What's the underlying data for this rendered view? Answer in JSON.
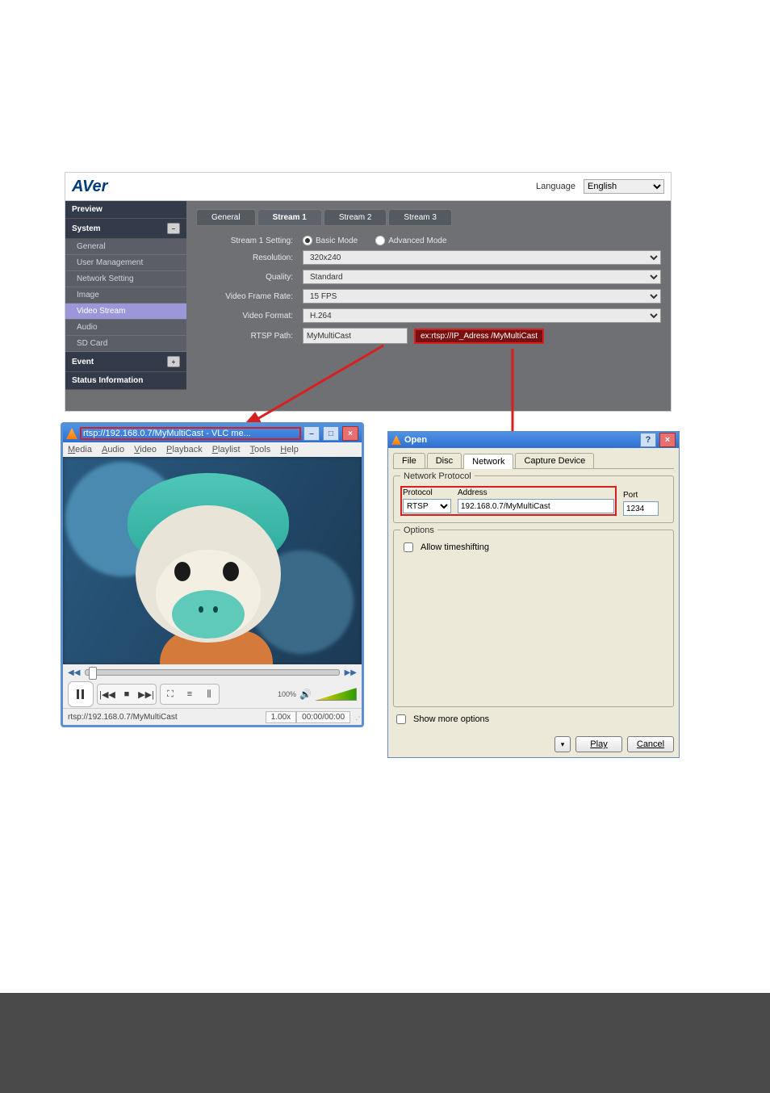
{
  "aver": {
    "logo": "AVer",
    "language_label": "Language",
    "language_value": "English",
    "sidebar": {
      "preview": "Preview",
      "system": "System",
      "items": [
        "General",
        "User Management",
        "Network Setting",
        "Image",
        "Video Stream",
        "Audio",
        "SD Card"
      ],
      "active_index": 4,
      "event": "Event",
      "status": "Status Information"
    },
    "tabs": [
      "General",
      "Stream 1",
      "Stream 2",
      "Stream 3"
    ],
    "active_tab": 1,
    "form": {
      "setting_label": "Stream 1 Setting:",
      "mode_basic": "Basic Mode",
      "mode_advanced": "Advanced Mode",
      "resolution_label": "Resolution:",
      "resolution_value": "320x240",
      "quality_label": "Quality:",
      "quality_value": "Standard",
      "fps_label": "Video Frame Rate:",
      "fps_value": "15 FPS",
      "format_label": "Video Format:",
      "format_value": "H.264",
      "rtsp_label": "RTSP Path:",
      "rtsp_value": "MyMultiCast",
      "rtsp_hint": "ex:rtsp://IP_Adress /MyMultiCast"
    }
  },
  "vlc": {
    "title": "rtsp://192.168.0.7/MyMultiCast - VLC me...",
    "menu": [
      "Media",
      "Audio",
      "Video",
      "Playback",
      "Playlist",
      "Tools",
      "Help"
    ],
    "volume_label": "100%",
    "status_path": "rtsp://192.168.0.7/MyMultiCast",
    "status_rate": "1.00x",
    "status_time": "00:00/00:00"
  },
  "dlg": {
    "title": "Open",
    "tabs": [
      "File",
      "Disc",
      "Network",
      "Capture Device"
    ],
    "active_tab": 2,
    "net_legend": "Network Protocol",
    "protocol_label": "Protocol",
    "protocol_value": "RTSP",
    "address_label": "Address",
    "address_value": "192.168.0.7/MyMultiCast",
    "port_label": "Port",
    "port_value": "1234",
    "options_legend": "Options",
    "timeshift_label": "Allow timeshifting",
    "more_label": "Show more options",
    "play": "Play",
    "cancel": "Cancel"
  }
}
